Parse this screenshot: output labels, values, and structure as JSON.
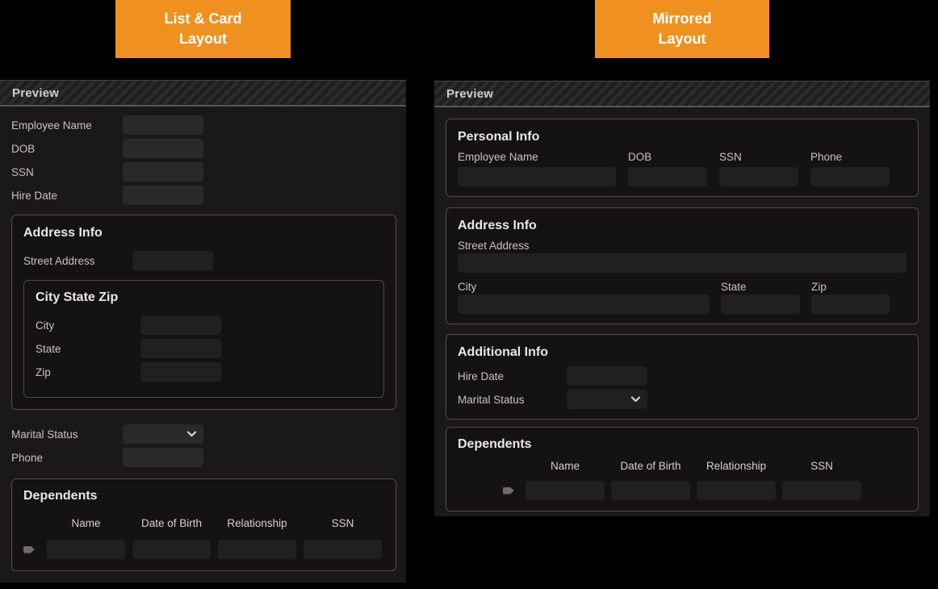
{
  "colors": {
    "accent": "#f0911f",
    "panel_bg": "#1b1818",
    "card_bg": "#151212",
    "card_border": "#504c48",
    "input_bg": "#2b2828"
  },
  "badges": {
    "left": {
      "line1": "List & Card",
      "line2": "Layout"
    },
    "right": {
      "line1": "Mirrored",
      "line2": "Layout"
    }
  },
  "left_panel": {
    "header": "Preview",
    "fields": [
      "Employee Name",
      "DOB",
      "SSN",
      "Hire Date"
    ],
    "address_card": {
      "title": "Address Info",
      "street_label": "Street Address",
      "nested_card": {
        "title": "City State Zip",
        "fields": [
          "City",
          "State",
          "Zip"
        ]
      }
    },
    "marital_label": "Marital Status",
    "phone_label": "Phone",
    "dependents_card": {
      "title": "Dependents",
      "columns": [
        "Name",
        "Date of Birth",
        "Relationship",
        "SSN"
      ]
    }
  },
  "right_panel": {
    "header": "Preview",
    "personal_card": {
      "title": "Personal Info",
      "fields": [
        "Employee Name",
        "DOB",
        "SSN",
        "Phone"
      ]
    },
    "address_card": {
      "title": "Address Info",
      "street_label": "Street Address",
      "row_fields": [
        "City",
        "State",
        "Zip"
      ]
    },
    "additional_card": {
      "title": "Additional Info",
      "hire_label": "Hire Date",
      "marital_label": "Marital Status"
    },
    "dependents_card": {
      "title": "Dependents",
      "columns": [
        "Name",
        "Date of Birth",
        "Relationship",
        "SSN"
      ]
    }
  }
}
